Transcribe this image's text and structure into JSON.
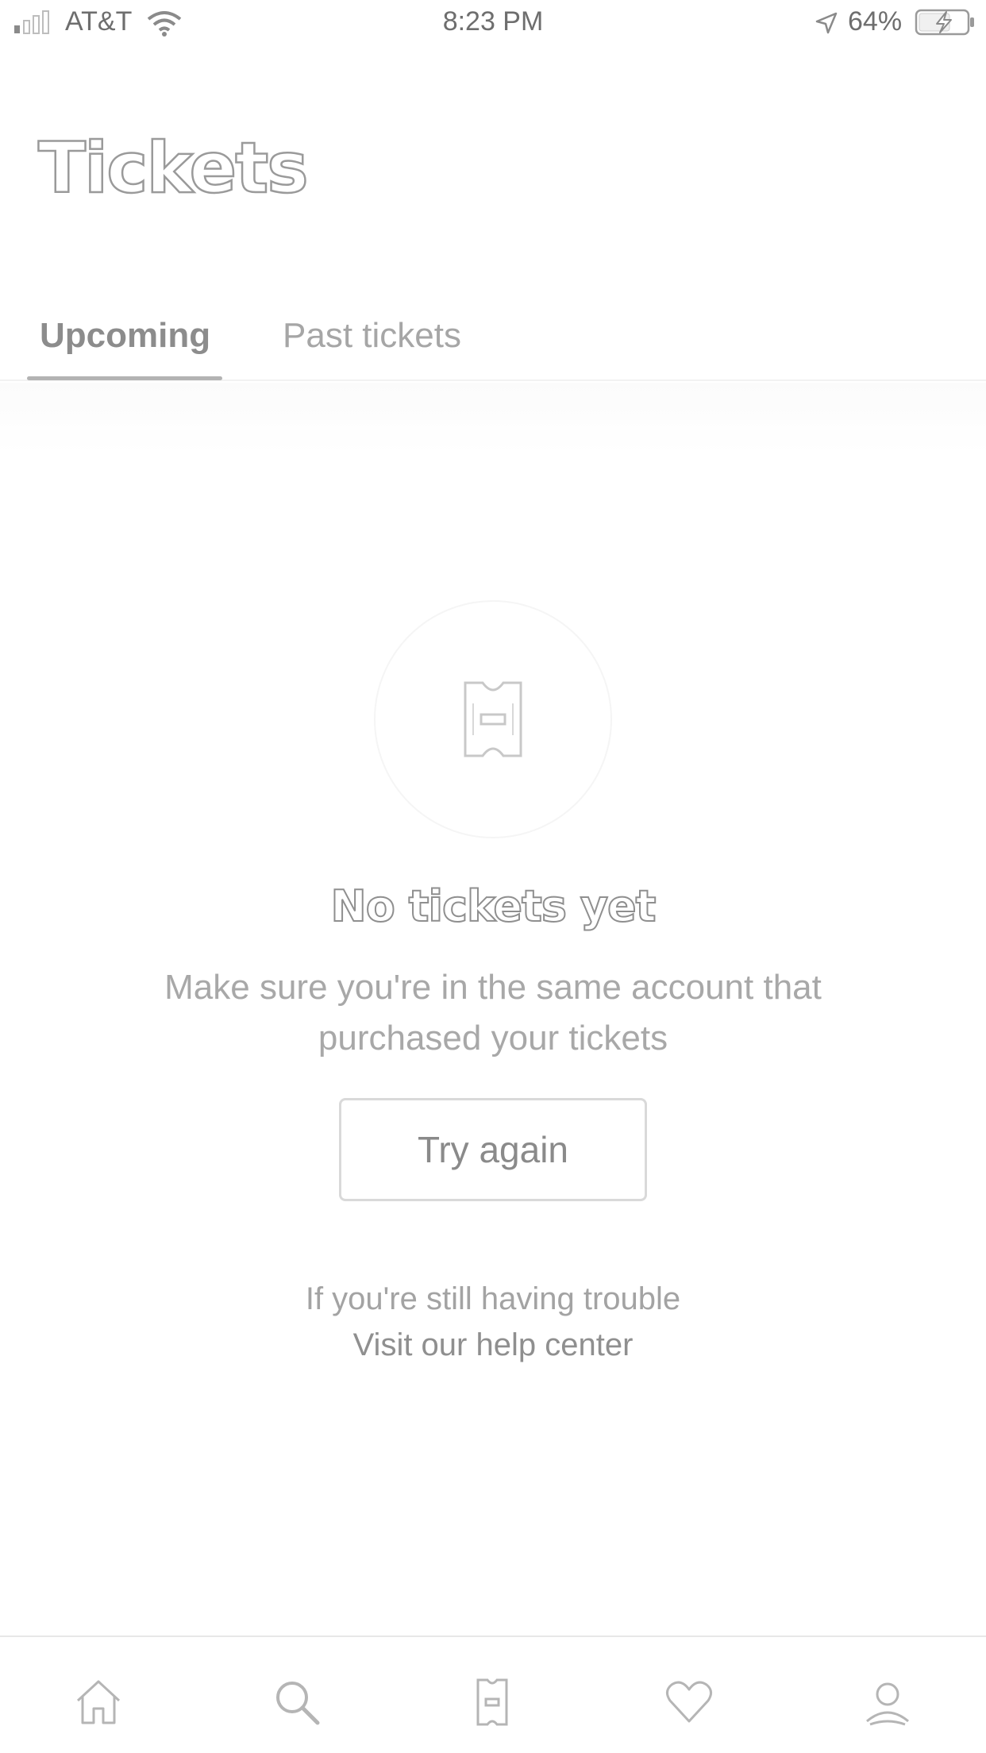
{
  "status_bar": {
    "carrier": "AT&T",
    "time": "8:23 PM",
    "battery": "64%"
  },
  "header": {
    "title": "Tickets"
  },
  "tabs": [
    {
      "label": "Upcoming",
      "selected": true
    },
    {
      "label": "Past tickets",
      "selected": false
    }
  ],
  "empty_state": {
    "icon": "ticket-icon",
    "title": "No tickets yet",
    "message": "Make sure you're in the same account that purchased your tickets",
    "button_label": "Try again",
    "help_text": "If you're still having trouble",
    "help_link": "Visit our help center"
  },
  "bottom_nav": [
    {
      "icon": "home-icon"
    },
    {
      "icon": "search-icon"
    },
    {
      "icon": "ticket-icon"
    },
    {
      "icon": "heart-icon"
    },
    {
      "icon": "profile-icon"
    }
  ]
}
